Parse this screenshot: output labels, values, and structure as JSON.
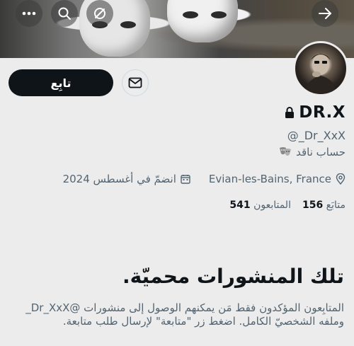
{
  "profile": {
    "display_name": "DR.X",
    "handle": "@_Dr_XxX",
    "label": "حساب ناقد",
    "location": "Evian-les-Bains, France",
    "joined": "انضمّ في أغسطس 2024",
    "following_count": "156",
    "following_label": "متابَع",
    "followers_count": "541",
    "followers_label": "المتابعون"
  },
  "actions": {
    "follow_label": "تابِع"
  },
  "protected": {
    "headline": "تلك المنشورات محميّة.",
    "description": "المتابِعون المؤكدون فقط مَن يمكنهم الوصول إلى منشورات @Dr_XxX_ وملفه الشخصيّ الكامل. اضغط زر \"متابعة\" لإرسال طلب متابعة."
  },
  "icons": {
    "top_left": [
      "more-icon",
      "search-icon",
      "no-sync-icon"
    ],
    "top_right": "arrow-right-icon"
  },
  "colors": {
    "primary_button": "#0f1419",
    "secondary_text": "#536471",
    "background": "#ececec"
  }
}
